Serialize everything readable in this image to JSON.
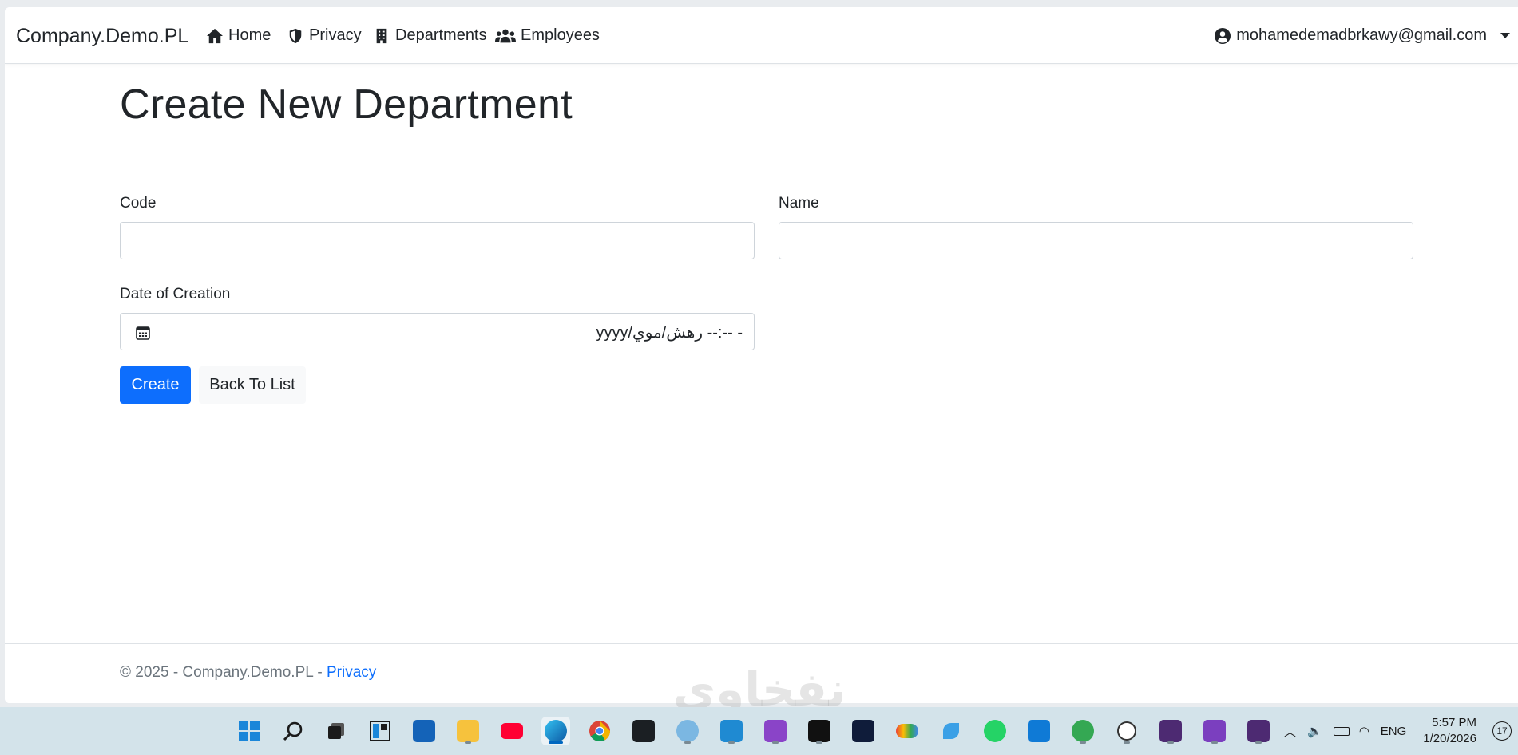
{
  "navbar": {
    "brand": "Company.Demo.PL",
    "links": [
      {
        "label": "Home",
        "icon": "home-icon"
      },
      {
        "label": "Privacy",
        "icon": "shield-icon"
      },
      {
        "label": "Departments",
        "icon": "building-icon"
      },
      {
        "label": "Employees",
        "icon": "users-icon"
      }
    ],
    "user": "mohamedemadbrkawy@gmail.com"
  },
  "page": {
    "title": "Create New Department"
  },
  "form": {
    "code_label": "Code",
    "code_value": "",
    "name_label": "Name",
    "name_value": "",
    "date_label": "Date of Creation",
    "date_value": "yyyy/رهش/موي --:-- -",
    "create_label": "Create",
    "back_label": "Back To List"
  },
  "footer": {
    "copyright": "© 2025 - Company.Demo.PL - ",
    "privacy_link": "Privacy"
  },
  "watermark": "نفخاوي",
  "colors": {
    "primary": "#0d6efd",
    "text": "#212529",
    "muted": "#6c757d",
    "taskbar": "#d3e3ea"
  },
  "taskbar": {
    "apps": [
      "windows-start-icon",
      "search-icon",
      "task-view-icon",
      "widgets-icon",
      "microsoft-store-icon",
      "file-explorer-icon",
      "youtube-icon",
      "edge-icon",
      "chrome-icon",
      "github-icon",
      "app-icon",
      "vscode-icon",
      "visual-studio-insiders-icon",
      "app-icon",
      "app-icon",
      "google-cloud-icon",
      "app-icon",
      "whatsapp-icon",
      "mail-icon",
      "chrome-profile-icon",
      "chatgpt-icon",
      "terminal-icon",
      "visual-studio-icon",
      "terminal-icon"
    ],
    "lang": "ENG",
    "time": "5:57 PM",
    "date": "1/20/2026",
    "notifications": "17"
  }
}
